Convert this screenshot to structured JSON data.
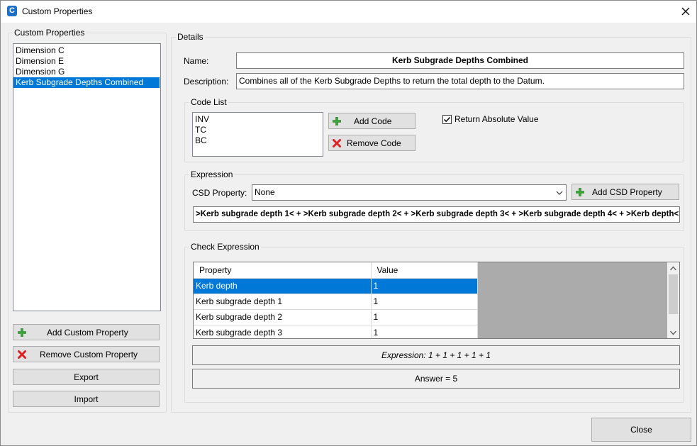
{
  "window": {
    "title": "Custom Properties"
  },
  "left_panel": {
    "group_title": "Custom Properties",
    "items": [
      {
        "label": "Dimension C"
      },
      {
        "label": "Dimension E"
      },
      {
        "label": "Dimension G"
      },
      {
        "label": "Kerb Subgrade Depths Combined",
        "selected": true
      }
    ],
    "add_button": "Add Custom Property",
    "remove_button": "Remove Custom Property",
    "export_button": "Export",
    "import_button": "Import"
  },
  "details": {
    "group_title": "Details",
    "name_label": "Name:",
    "name_value": "Kerb Subgrade Depths Combined",
    "description_label": "Description:",
    "description_value": "Combines all of the Kerb Subgrade Depths to return the total depth to the Datum.",
    "code_list": {
      "group_title": "Code List",
      "codes": [
        "INV",
        "TC",
        "BC"
      ],
      "add_button": "Add Code",
      "remove_button": "Remove Code",
      "return_absolute_label": "Return Absolute Value",
      "return_absolute_checked": true
    },
    "expression": {
      "group_title": "Expression",
      "csd_property_label": "CSD Property:",
      "csd_property_value": "None",
      "add_csd_button": "Add CSD Property",
      "expression_text": ">Kerb subgrade depth 1< + >Kerb subgrade depth 2< + >Kerb subgrade depth 3< + >Kerb subgrade depth 4< +  >Kerb depth<"
    },
    "check_expression": {
      "group_title": "Check Expression",
      "columns": [
        "Property",
        "Value"
      ],
      "rows": [
        {
          "property": "Kerb depth",
          "value": "1",
          "selected": true
        },
        {
          "property": "Kerb subgrade depth 1",
          "value": "1"
        },
        {
          "property": "Kerb subgrade depth 2",
          "value": "1"
        },
        {
          "property": "Kerb subgrade depth 3",
          "value": "1"
        }
      ],
      "expression_result": "Expression: 1 + 1 + 1 + 1 +  1",
      "answer": "Answer = 5"
    }
  },
  "close_button": "Close",
  "icons": {
    "add": "plus-icon",
    "remove": "x-icon",
    "app": "app-logo-icon",
    "close": "close-icon",
    "dropdown": "chevron-down-icon",
    "check": "checkmark-icon"
  },
  "colors": {
    "selection": "#0078d7",
    "add_icon": "#3aa43a",
    "remove_icon": "#e02020",
    "app_icon": "#1e6fc7"
  }
}
